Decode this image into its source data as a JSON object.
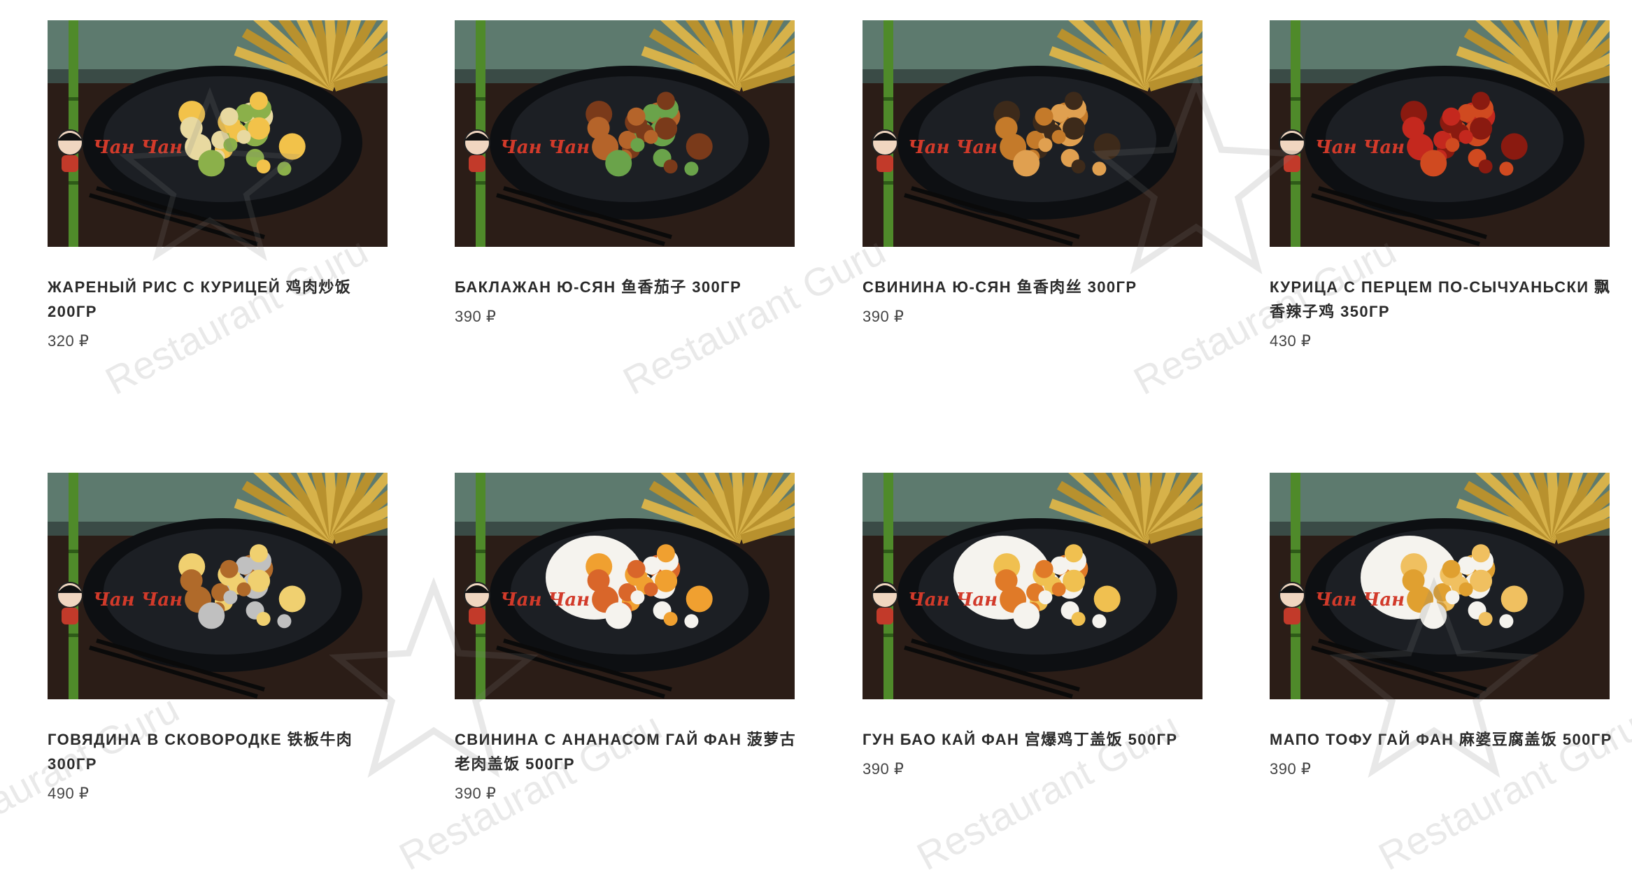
{
  "watermark_text": "Restaurant Guru",
  "currency": "₽",
  "items": [
    {
      "title": "ЖАРЕНЫЙ РИС С КУРИЦЕЙ 鸡肉炒饭 200ГР",
      "price": "320 ₽",
      "dish": "fried-rice",
      "photo_logo": "Чан Чан"
    },
    {
      "title": "БАКЛАЖАН Ю-СЯН 鱼香茄子 300ГР",
      "price": "390 ₽",
      "dish": "eggplant",
      "photo_logo": "Чан Чан"
    },
    {
      "title": "СВИНИНА Ю-СЯН 鱼香肉丝 300ГР",
      "price": "390 ₽",
      "dish": "pork-strips",
      "photo_logo": "Чан Чан"
    },
    {
      "title": "КУРИЦА С ПЕРЦЕМ ПО-СЫЧУАНЬСКИ 飘香辣子鸡 350ГР",
      "price": "430 ₽",
      "dish": "sichuan-chicken",
      "photo_logo": "Чан Чан"
    },
    {
      "title": "ГОВЯДИНА В СКОВОРОДКЕ 铁板牛肉 300ГР",
      "price": "490 ₽",
      "dish": "sizzling-beef",
      "photo_logo": "Чан Чан"
    },
    {
      "title": "СВИНИНА С АНАНАСОМ ГАЙ ФАН 菠萝古老肉盖饭 500ГР",
      "price": "390 ₽",
      "dish": "pineapple-pork",
      "photo_logo": "Чан Чан"
    },
    {
      "title": "ГУН БАО КАЙ ФАН 宫爆鸡丁盖饭 500ГР",
      "price": "390 ₽",
      "dish": "gongbao",
      "photo_logo": "Чан Чан"
    },
    {
      "title": "МАПО ТОФУ ГАЙ ФАН 麻婆豆腐盖饭 500ГР",
      "price": "390 ₽",
      "dish": "mapo-tofu",
      "photo_logo": "Чан Чан"
    }
  ],
  "colors": {
    "background": "#ffffff",
    "title": "#2a2a2a",
    "price": "#444444",
    "plate": "#0d0f12",
    "table": "#2b1d17",
    "bamboo": "#4f8a2a",
    "fan": "#d7b24a"
  }
}
